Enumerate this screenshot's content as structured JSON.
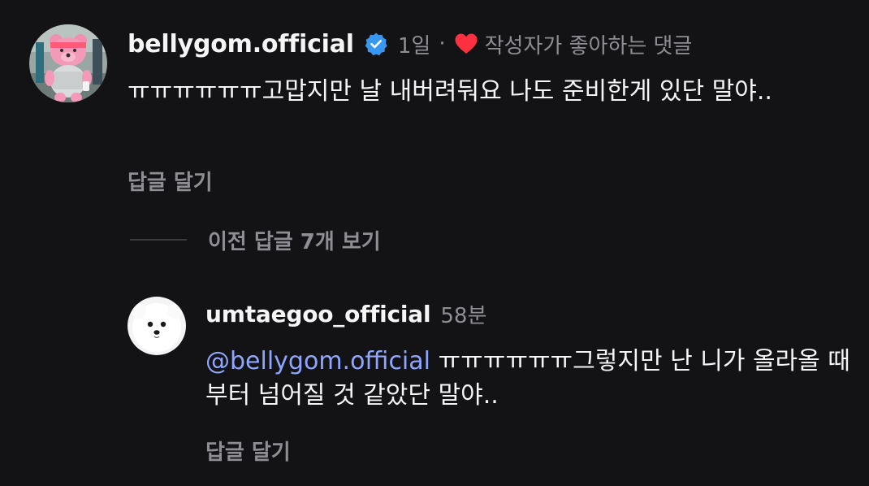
{
  "comment": {
    "username": "bellygom.official",
    "time": "1일",
    "separator": "·",
    "liked_by_author": "작성자가 좋아하는 댓글",
    "text": "ㅠㅠㅠㅠㅠㅠ고맙지만 날 내버려둬요 나도 준비한게 있단 말야..",
    "reply_action": "답글 달기"
  },
  "view_replies": {
    "label": "이전 답글 7개 보기"
  },
  "reply": {
    "username": "umtaegoo_official",
    "time": "58분",
    "mention": "@bellygom.official",
    "text": "ㅠㅠㅠㅠㅠㅠ그렇지만 난 니가 올라올 때부터 넘어질 것 같았단 말야..",
    "reply_action": "답글 달기"
  },
  "colors": {
    "background": "#131316",
    "verified": "#3897f0",
    "heart": "#ff3040",
    "mention": "#8fa6ff"
  },
  "icons": {
    "verified": "verified-badge-icon",
    "heart": "heart-icon"
  }
}
